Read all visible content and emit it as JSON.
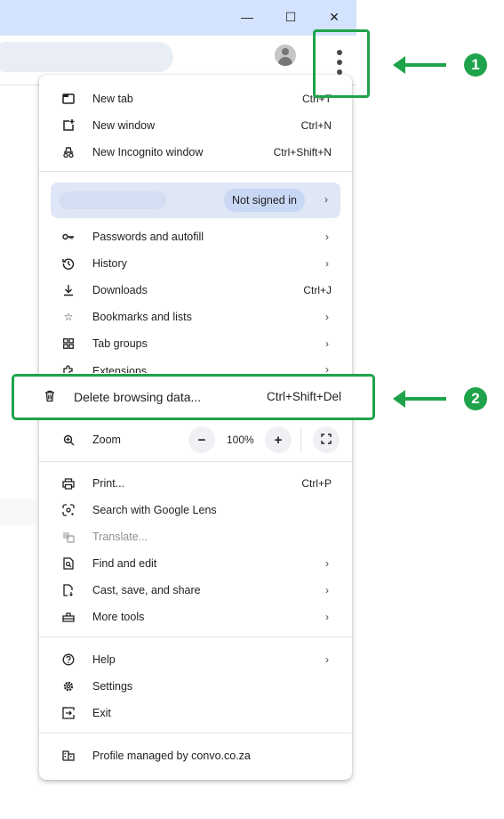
{
  "window": {
    "minimize_glyph": "—",
    "maximize_glyph": "☐",
    "close_glyph": "✕"
  },
  "annotations": {
    "badge_1": "1",
    "badge_2": "2",
    "accent_color": "#1ea34a"
  },
  "menu": {
    "group1": [
      {
        "label": "New tab",
        "shortcut": "Ctrl+T",
        "icon": "new-tab-icon"
      },
      {
        "label": "New window",
        "shortcut": "Ctrl+N",
        "icon": "new-window-icon"
      },
      {
        "label": "New Incognito window",
        "shortcut": "Ctrl+Shift+N",
        "icon": "incognito-icon"
      }
    ],
    "profile": {
      "status": "Not signed in"
    },
    "group2": [
      {
        "label": "Passwords and autofill",
        "icon": "key-icon"
      },
      {
        "label": "History",
        "icon": "history-icon"
      },
      {
        "label": "Downloads",
        "shortcut": "Ctrl+J",
        "icon": "download-icon"
      },
      {
        "label": "Bookmarks and lists",
        "icon": "star-icon"
      },
      {
        "label": "Tab groups",
        "icon": "tab-groups-icon"
      },
      {
        "label": "Extensions",
        "icon": "extensions-icon"
      }
    ],
    "delete_browsing": {
      "label": "Delete browsing data...",
      "shortcut": "Ctrl+Shift+Del",
      "icon": "trash-icon"
    },
    "zoom": {
      "label": "Zoom",
      "value": "100%",
      "minus": "−",
      "plus": "+"
    },
    "group3": [
      {
        "label": "Print...",
        "shortcut": "Ctrl+P",
        "icon": "print-icon"
      },
      {
        "label": "Search with Google Lens",
        "icon": "lens-icon"
      },
      {
        "label": "Translate...",
        "icon": "translate-icon",
        "disabled": true
      },
      {
        "label": "Find and edit",
        "icon": "find-icon"
      },
      {
        "label": "Cast, save, and share",
        "icon": "cast-icon"
      },
      {
        "label": "More tools",
        "icon": "toolbox-icon"
      }
    ],
    "group4": [
      {
        "label": "Help",
        "icon": "help-icon"
      },
      {
        "label": "Settings",
        "icon": "settings-icon"
      },
      {
        "label": "Exit",
        "icon": "exit-icon"
      }
    ],
    "managed": {
      "label": "Profile managed by convo.co.za",
      "icon": "building-icon"
    }
  }
}
